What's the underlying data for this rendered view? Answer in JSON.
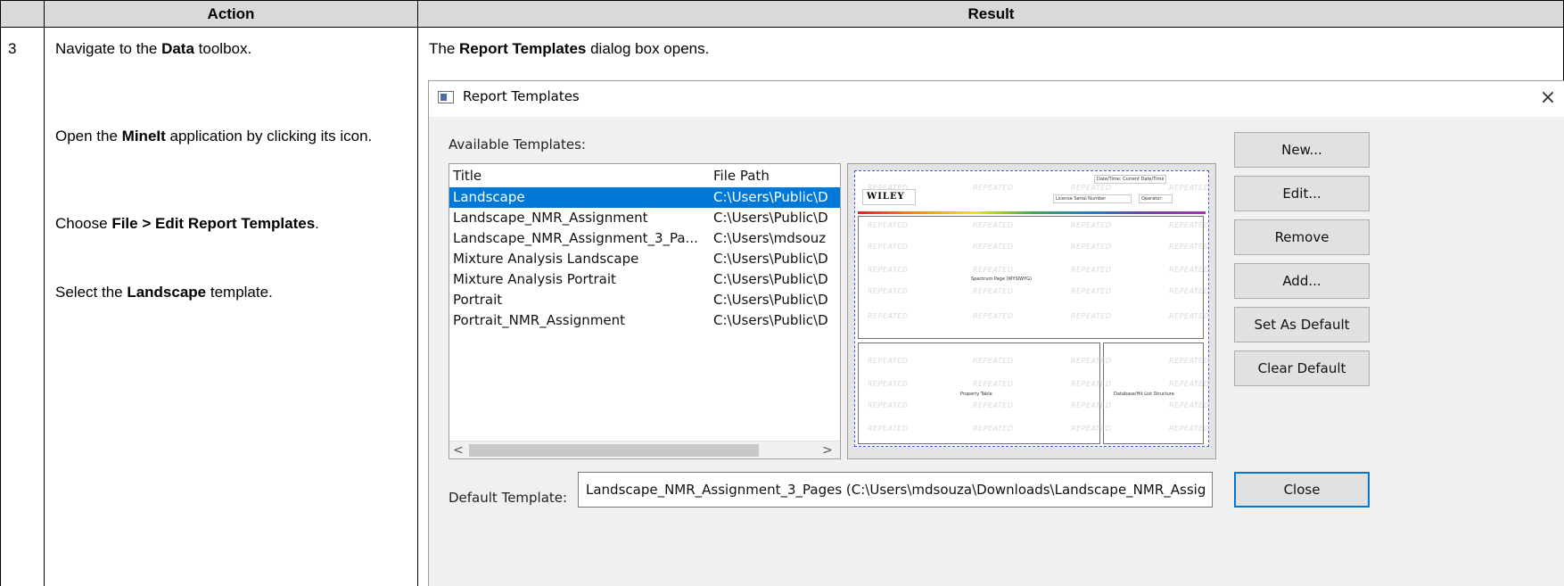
{
  "table": {
    "header": {
      "action": "Action",
      "result": "Result"
    },
    "row_number": "3",
    "action_steps": [
      {
        "pre": "Navigate to the ",
        "bold": "Data",
        "post": " toolbox."
      },
      {
        "pre": "Open the ",
        "bold": "MineIt",
        "post": " application by clicking its icon."
      },
      {
        "pre": "Choose ",
        "bold": "File > Edit Report Templates",
        "post": "."
      },
      {
        "pre": "Select the ",
        "bold": "Landscape",
        "post": " template."
      }
    ],
    "result_intro": {
      "pre": "The ",
      "bold": "Report Templates",
      "post": " dialog box opens."
    }
  },
  "dialog": {
    "title": "Report Templates",
    "close_glyph": "×",
    "available_label": "Available Templates:",
    "columns": {
      "title": "Title",
      "file_path": "File Path"
    },
    "templates": [
      {
        "title": "Landscape",
        "path": "C:\\Users\\Public\\D",
        "selected": true
      },
      {
        "title": "Landscape_NMR_Assignment",
        "path": "C:\\Users\\Public\\D",
        "selected": false
      },
      {
        "title": "Landscape_NMR_Assignment_3_Pa...",
        "path": "C:\\Users\\mdsouz",
        "selected": false
      },
      {
        "title": "Mixture Analysis Landscape",
        "path": "C:\\Users\\Public\\D",
        "selected": false
      },
      {
        "title": "Mixture Analysis Portrait",
        "path": "C:\\Users\\Public\\D",
        "selected": false
      },
      {
        "title": "Portrait",
        "path": "C:\\Users\\Public\\D",
        "selected": false
      },
      {
        "title": "Portrait_NMR_Assignment",
        "path": "C:\\Users\\Public\\D",
        "selected": false
      }
    ],
    "scroll_left": "<",
    "scroll_right": ">",
    "preview": {
      "logo": "WILEY",
      "date_time_label": "Date/Time:",
      "date_time_value": "Current Date/Time",
      "license": "License Serial Number",
      "operator": "Operator:",
      "spectrum": "Spectrum Page (WYSIWYG)",
      "property_table": "Property Table",
      "hit_list": "Database/Hit List Structure",
      "watermark": "REPEATED"
    },
    "buttons": {
      "new": "New...",
      "edit": "Edit...",
      "remove": "Remove",
      "add": "Add...",
      "set_default": "Set As Default",
      "clear_default": "Clear Default",
      "close": "Close"
    },
    "default_label": "Default Template:",
    "default_value": "Landscape_NMR_Assignment_3_Pages (C:\\Users\\mdsouza\\Downloads\\Landscape_NMR_Assig"
  }
}
